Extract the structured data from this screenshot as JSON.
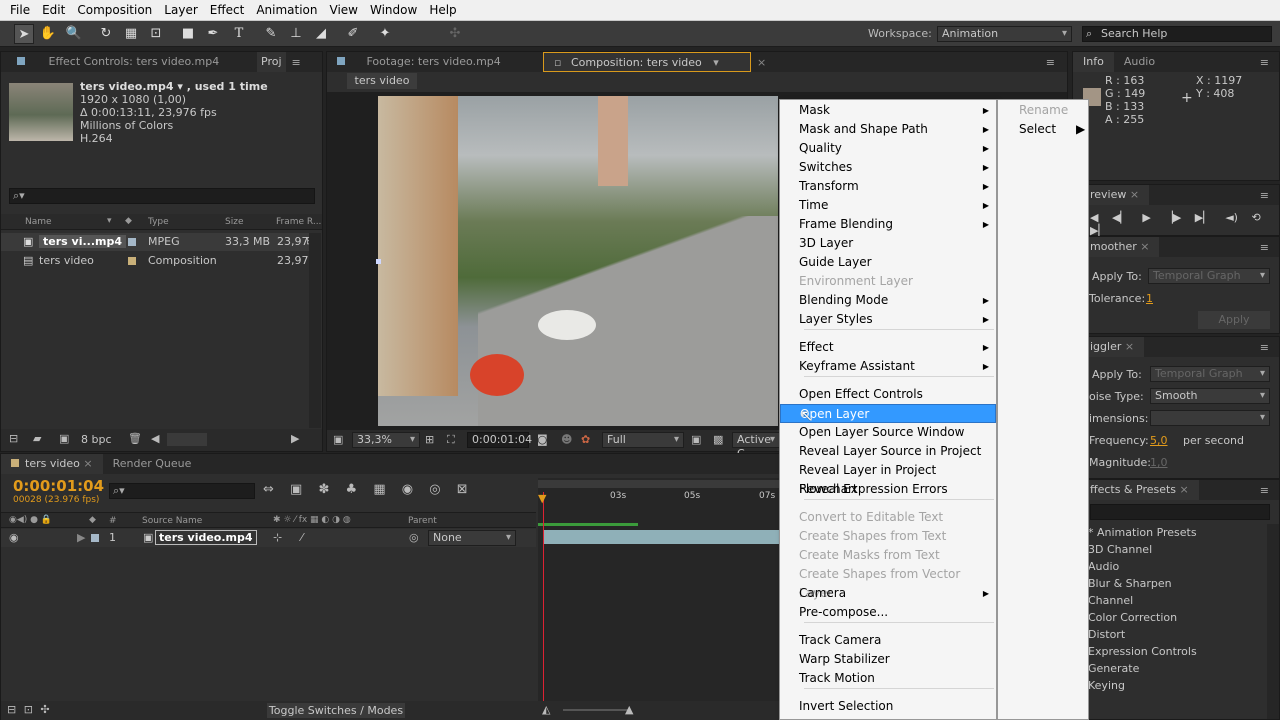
{
  "menubar": [
    "File",
    "Edit",
    "Composition",
    "Layer",
    "Effect",
    "Animation",
    "View",
    "Window",
    "Help"
  ],
  "toolbar": {
    "workspace_label": "Workspace:",
    "workspace_value": "Animation",
    "search_placeholder": "Search Help"
  },
  "project_panel": {
    "tab_effect_controls": "Effect Controls: ters video.mp4",
    "tab_project": "Proj",
    "file_name": "ters video.mp4 ▾ , used 1 time",
    "resolution": "1920 x 1080 (1,00)",
    "duration": "Δ 0:00:13:11, 23,976 fps",
    "colors": "Millions of Colors",
    "codec": "H.264",
    "search_placeholder": "",
    "columns": {
      "name": "Name",
      "type": "Type",
      "size": "Size",
      "frame_rate": "Frame R..."
    },
    "items": [
      {
        "name": "ters vi...mp4",
        "type": "MPEG",
        "size": "33,3 MB",
        "fps": "23,97"
      },
      {
        "name": "ters video",
        "type": "Composition",
        "size": "",
        "fps": "23,97"
      }
    ],
    "bpc": "8 bpc"
  },
  "viewer": {
    "tab_footage": "Footage: ters video.mp4",
    "tab_composition": "Composition: ters video",
    "comp_label": "ters video",
    "zoom": "33,3%",
    "timecode": "0:00:01:04",
    "resolution": "Full",
    "camera": "Active C"
  },
  "context_menu": {
    "items": [
      {
        "label": "Mask",
        "submenu": true,
        "disabled": false
      },
      {
        "label": "Mask and Shape Path",
        "submenu": true,
        "disabled": false
      },
      {
        "label": "Quality",
        "submenu": true,
        "disabled": false
      },
      {
        "label": "Switches",
        "submenu": true,
        "disabled": false
      },
      {
        "label": "Transform",
        "submenu": true,
        "disabled": false
      },
      {
        "label": "Time",
        "submenu": true,
        "disabled": false
      },
      {
        "label": "Frame Blending",
        "submenu": true,
        "disabled": false
      },
      {
        "label": "3D Layer",
        "submenu": false,
        "disabled": false
      },
      {
        "label": "Guide Layer",
        "submenu": false,
        "disabled": false
      },
      {
        "label": "Environment Layer",
        "submenu": false,
        "disabled": true
      },
      {
        "label": "Blending Mode",
        "submenu": true,
        "disabled": false
      },
      {
        "label": "Layer Styles",
        "submenu": true,
        "disabled": false
      },
      {
        "label": "Effect",
        "submenu": true,
        "disabled": false
      },
      {
        "label": "Keyframe Assistant",
        "submenu": true,
        "disabled": false
      },
      {
        "label": "Open Effect Controls",
        "submenu": false,
        "disabled": false
      },
      {
        "label": "Open Layer",
        "submenu": false,
        "disabled": false,
        "highlighted": true
      },
      {
        "label": "Open Layer Source Window",
        "submenu": false,
        "disabled": false
      },
      {
        "label": "Reveal Layer Source in Project",
        "submenu": false,
        "disabled": false
      },
      {
        "label": "Reveal Layer in Project Flowchart",
        "submenu": false,
        "disabled": false
      },
      {
        "label": "Reveal Expression Errors",
        "submenu": false,
        "disabled": false
      },
      {
        "label": "Convert to Editable Text",
        "submenu": false,
        "disabled": true
      },
      {
        "label": "Create Shapes from Text",
        "submenu": false,
        "disabled": true
      },
      {
        "label": "Create Masks from Text",
        "submenu": false,
        "disabled": true
      },
      {
        "label": "Create Shapes from Vector Layer",
        "submenu": false,
        "disabled": true
      },
      {
        "label": "Camera",
        "submenu": true,
        "disabled": false
      },
      {
        "label": "Pre-compose...",
        "submenu": false,
        "disabled": false
      },
      {
        "label": "Track Camera",
        "submenu": false,
        "disabled": false
      },
      {
        "label": "Warp Stabilizer",
        "submenu": false,
        "disabled": false
      },
      {
        "label": "Track Motion",
        "submenu": false,
        "disabled": false
      },
      {
        "label": "Invert Selection",
        "submenu": false,
        "disabled": false
      }
    ],
    "sub_items": [
      {
        "label": "Rename",
        "disabled": true,
        "submenu": false
      },
      {
        "label": "Select",
        "disabled": false,
        "submenu": true
      }
    ]
  },
  "info_panel": {
    "tab_info": "Info",
    "tab_audio": "Audio",
    "r": "R : 163",
    "g": "G : 149",
    "b": "B : 133",
    "a": "A : 255",
    "x": "X : 1197",
    "y": "Y : 408",
    "swatch_color": "#a39585"
  },
  "preview_panel": {
    "tab": "review"
  },
  "smoother_panel": {
    "tab": "moother",
    "apply_to_label": "Apply To:",
    "apply_to_value": "Temporal Graph",
    "tolerance_label": "Tolerance:",
    "tolerance_value": "1",
    "apply_button": "Apply"
  },
  "wiggler_panel": {
    "tab": "iggler",
    "apply_to_label": "Apply To:",
    "apply_to_value": "Temporal Graph",
    "noise_label": "oise Type:",
    "noise_value": "Smooth",
    "dimensions_label": "imensions:",
    "frequency_label": "Frequency:",
    "frequency_value": "5,0",
    "frequency_unit": "per second",
    "magnitude_label": "Magnitude:",
    "magnitude_value": "1,0"
  },
  "effects_panel": {
    "tab": "ffects & Presets",
    "items": [
      "* Animation Presets",
      "3D Channel",
      "Audio",
      "Blur & Sharpen",
      "Channel",
      "Color Correction",
      "Distort",
      "Expression Controls",
      "Generate",
      "Keying"
    ]
  },
  "timeline": {
    "tab_comp": "ters video",
    "tab_render": "Render Queue",
    "timecode": "0:00:01:04",
    "frame_info": "00028 (23.976 fps)",
    "col_source": "Source Name",
    "col_parent": "Parent",
    "layer_num": "1",
    "layer_name": "ters video.mp4",
    "parent_value": "None",
    "ruler": [
      "03s",
      "05s",
      "07s"
    ],
    "toggle": "Toggle Switches / Modes"
  }
}
